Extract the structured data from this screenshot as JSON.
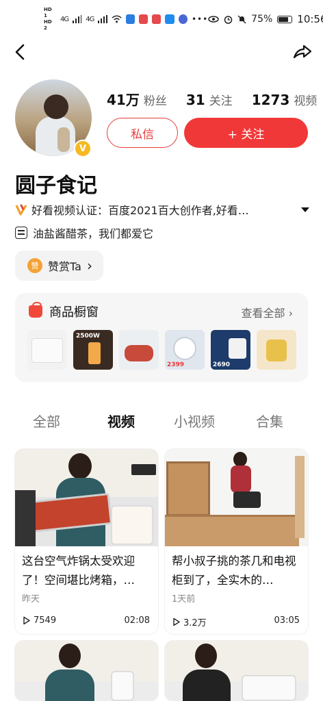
{
  "status_bar": {
    "hd1": "HD 1",
    "hd2": "HD 2",
    "net1": "4G",
    "net2": "4G",
    "battery": "75%",
    "time": "10:56"
  },
  "profile": {
    "fans_num": "41万",
    "fans_label": "粉丝",
    "following_num": "31",
    "following_label": "关注",
    "videos_num": "1273",
    "videos_label": "视频",
    "message_label": "私信",
    "follow_label": "+ 关注",
    "name": "圆子食记",
    "certification": "好看视频认证：百度2021百大创作者,好看…",
    "bio": "油盐酱醋茶，我们都爱它",
    "tip_label": "赞赏Ta",
    "tip_arrow": "›",
    "tip_coin": "赞"
  },
  "shop": {
    "title": "商品橱窗",
    "view_all": "查看全部",
    "view_all_arrow": "›",
    "products": [
      {
        "label": "",
        "bg": "#f2f2f2",
        "accent": "#e9e9e9"
      },
      {
        "label": "2500W",
        "bg": "#3a2b22",
        "accent": "#f3a84a"
      },
      {
        "label": "",
        "bg": "#eceff2",
        "accent": "#c84a3a"
      },
      {
        "label": "2399",
        "bg": "#dfe6ee",
        "accent": "#ffffff"
      },
      {
        "label": "2690",
        "bg": "#1d3b6b",
        "accent": "#f2f2f2"
      },
      {
        "label": "",
        "bg": "#f5e6c9",
        "accent": "#e8c14a"
      },
      {
        "label": "",
        "bg": "#8a8fa0",
        "accent": "#c9c9c9"
      }
    ]
  },
  "tabs": [
    {
      "label": "全部",
      "active": false
    },
    {
      "label": "视频",
      "active": true
    },
    {
      "label": "小视频",
      "active": false
    },
    {
      "label": "合集",
      "active": false
    }
  ],
  "videos": [
    {
      "title": "这台空气炸锅太受欢迎了！空间堪比烤箱，…",
      "date": "昨天",
      "plays": "7549",
      "duration": "02:08"
    },
    {
      "title": "帮小叔子挑的茶几和电视柜到了，全实木的…",
      "date": "1天前",
      "plays": "3.2万",
      "duration": "03:05"
    },
    {
      "title": "",
      "date": "",
      "plays": "",
      "duration": ""
    },
    {
      "title": "",
      "date": "",
      "plays": "",
      "duration": ""
    }
  ],
  "colors": {
    "accent": "#f13838",
    "badge": "#f5b922"
  }
}
